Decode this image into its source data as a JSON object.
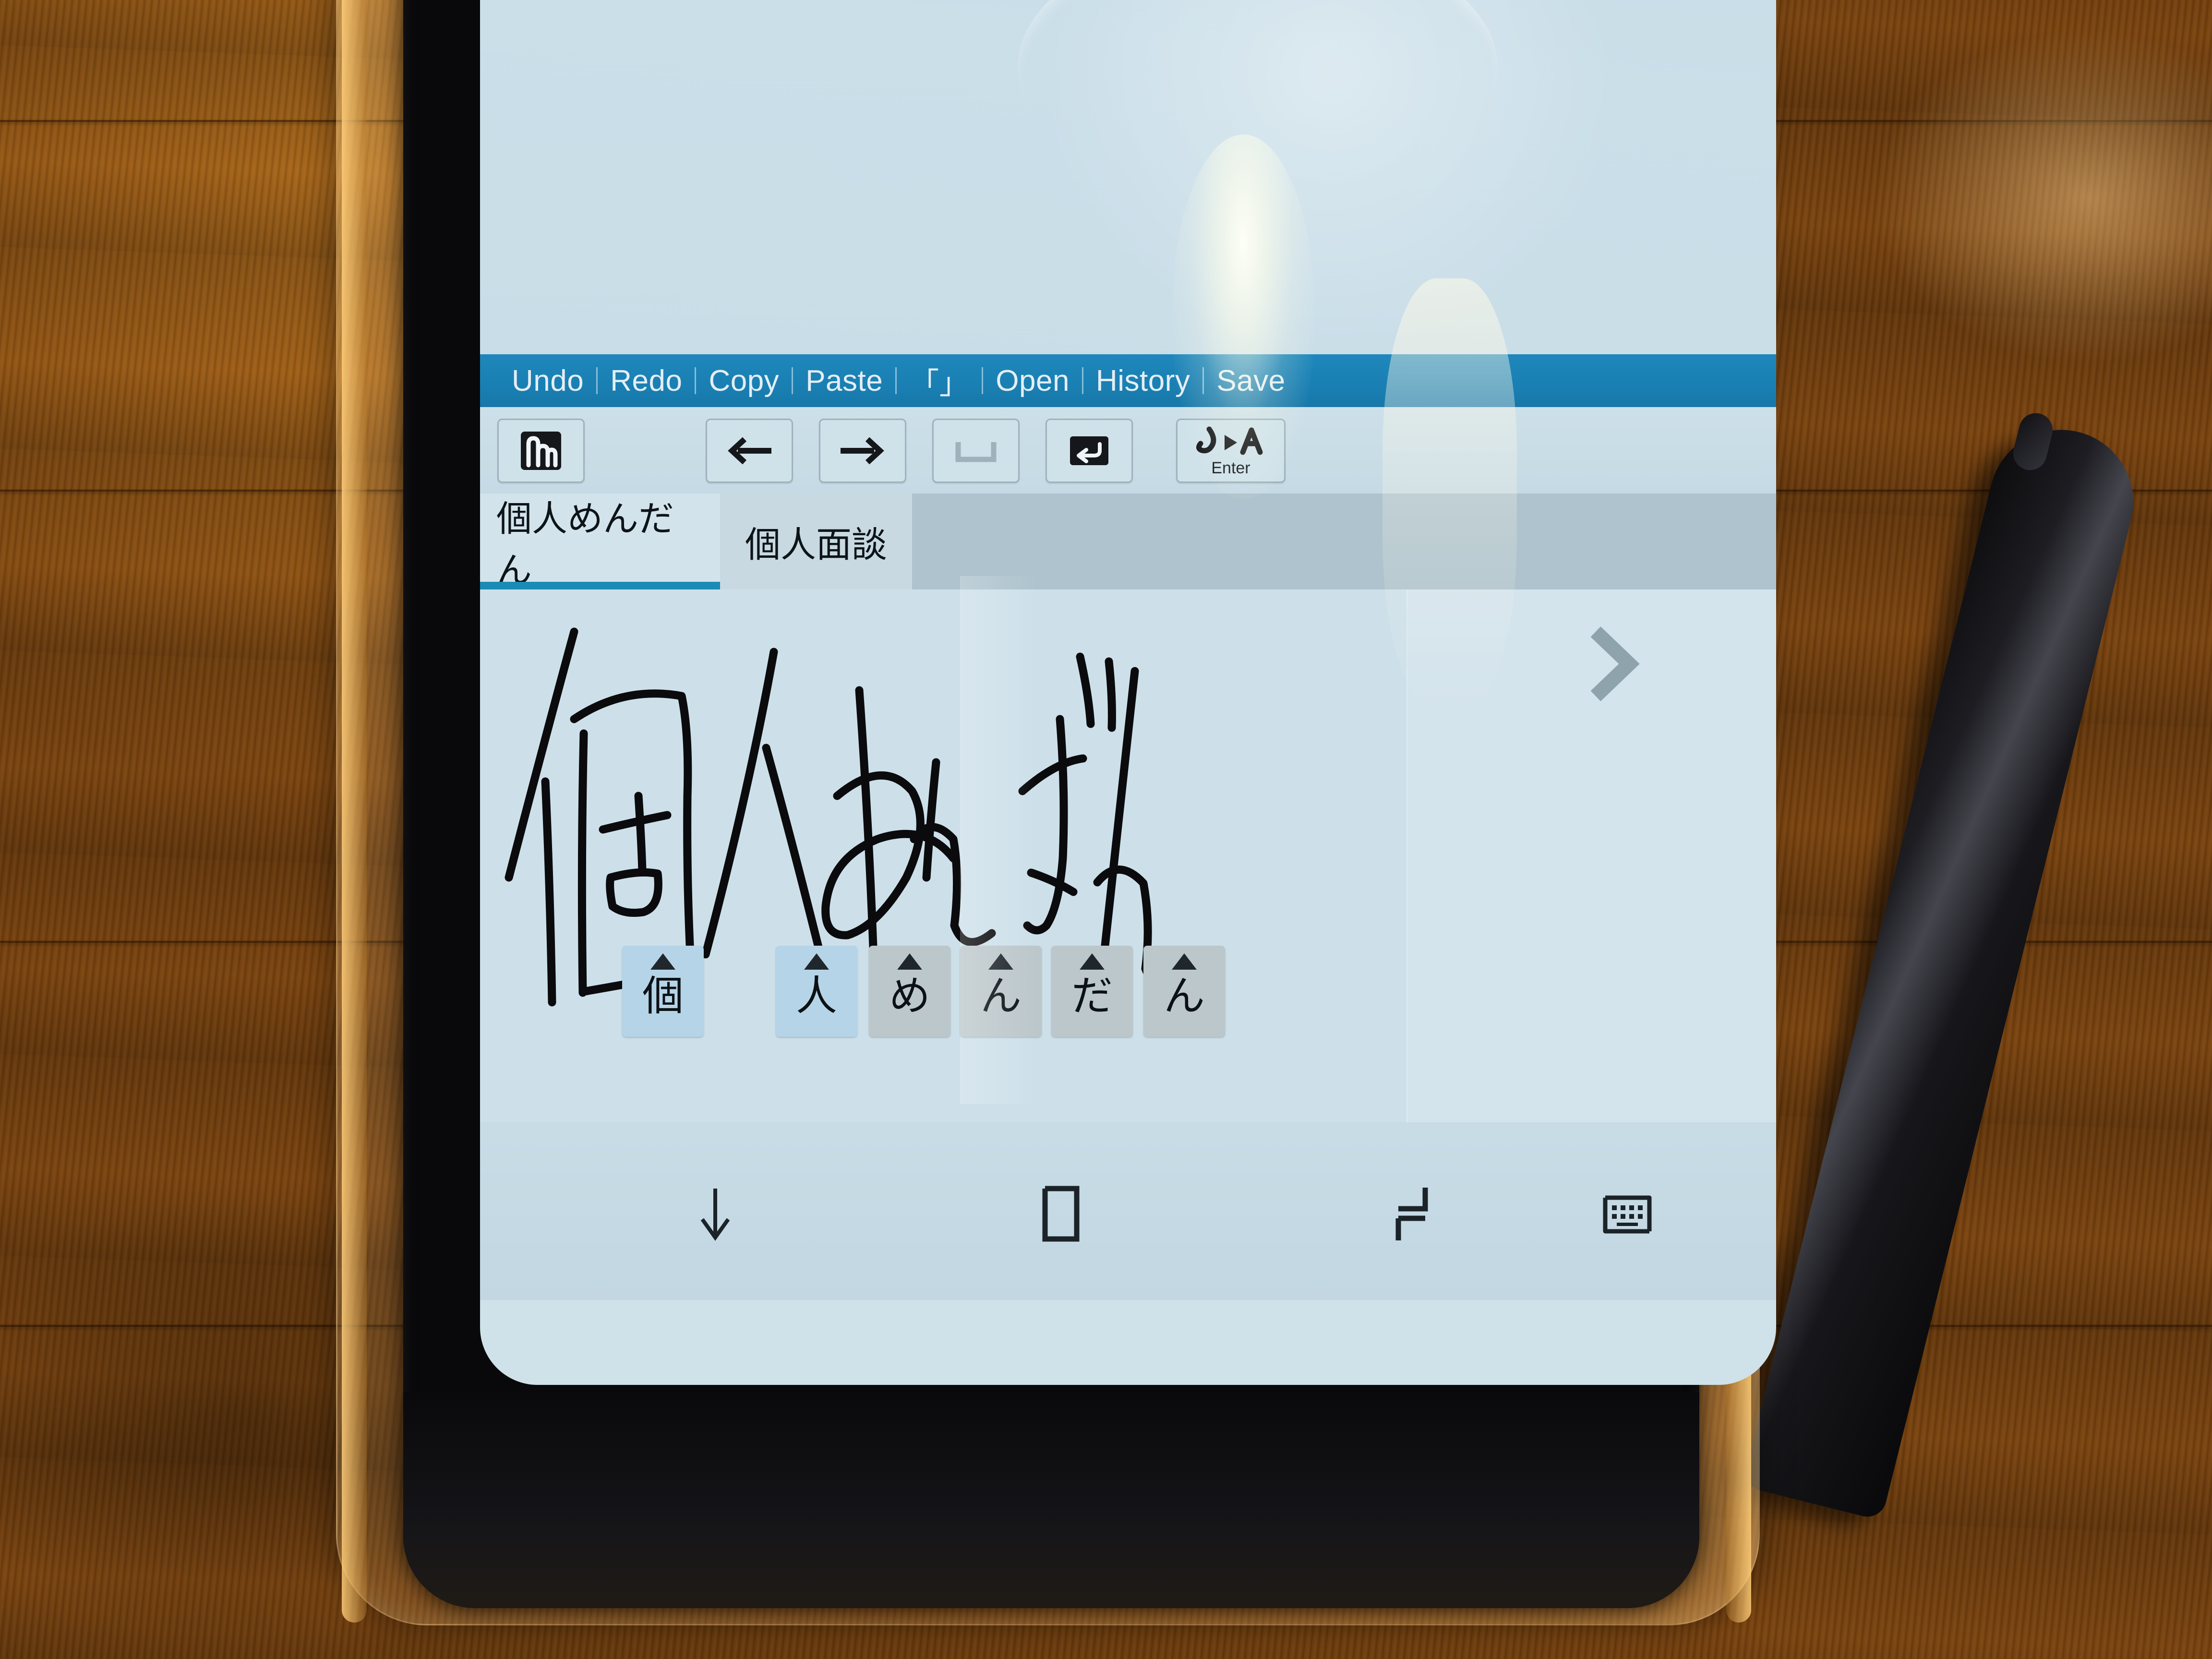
{
  "app": {
    "name": "mazec-handwriting-input",
    "screen_bg": "#cde0ea",
    "accent": "#1a80b4",
    "tab_underline": "#1a8bb5"
  },
  "fab": {
    "icon": "pen-icon",
    "label": ""
  },
  "menubar": {
    "items": [
      {
        "label": "Undo"
      },
      {
        "label": "Redo"
      },
      {
        "label": "Copy"
      },
      {
        "label": "Paste"
      },
      {
        "label": "「」"
      },
      {
        "label": "Open"
      },
      {
        "label": "History"
      },
      {
        "label": "Save"
      }
    ]
  },
  "toolbar": {
    "buttons": [
      {
        "icon": "handwriting-mode-icon",
        "label": ""
      },
      {
        "icon": "arrow-left-icon",
        "label": ""
      },
      {
        "icon": "arrow-right-icon",
        "label": ""
      },
      {
        "icon": "space-bar-icon",
        "label": ""
      },
      {
        "icon": "return-arrow-icon",
        "label": ""
      },
      {
        "icon": "convert-enter-icon",
        "label": "Enter"
      }
    ]
  },
  "candidates": {
    "tabs": [
      {
        "label": "個人めんだん",
        "active": true
      },
      {
        "label": "個人面談",
        "active": false
      }
    ]
  },
  "canvas": {
    "handwritten_text": "個人めんだん",
    "next_icon": "chevron-right-icon"
  },
  "chips": [
    {
      "char": "個",
      "selected": true
    },
    {
      "char": "人",
      "selected": true
    },
    {
      "char": "め",
      "selected": false
    },
    {
      "char": "ん",
      "selected": false
    },
    {
      "char": "だ",
      "selected": false
    },
    {
      "char": "ん",
      "selected": false
    }
  ],
  "navbar": {
    "buttons": [
      {
        "icon": "hide-keyboard-down-arrow-icon"
      },
      {
        "icon": "home-square-icon"
      },
      {
        "icon": "recents-switch-icon"
      },
      {
        "icon": "keyboard-icon"
      }
    ]
  },
  "scene": {
    "device": "smartphone-in-clear-case",
    "surface": "wooden-table",
    "object": "black-stylus-pen"
  }
}
